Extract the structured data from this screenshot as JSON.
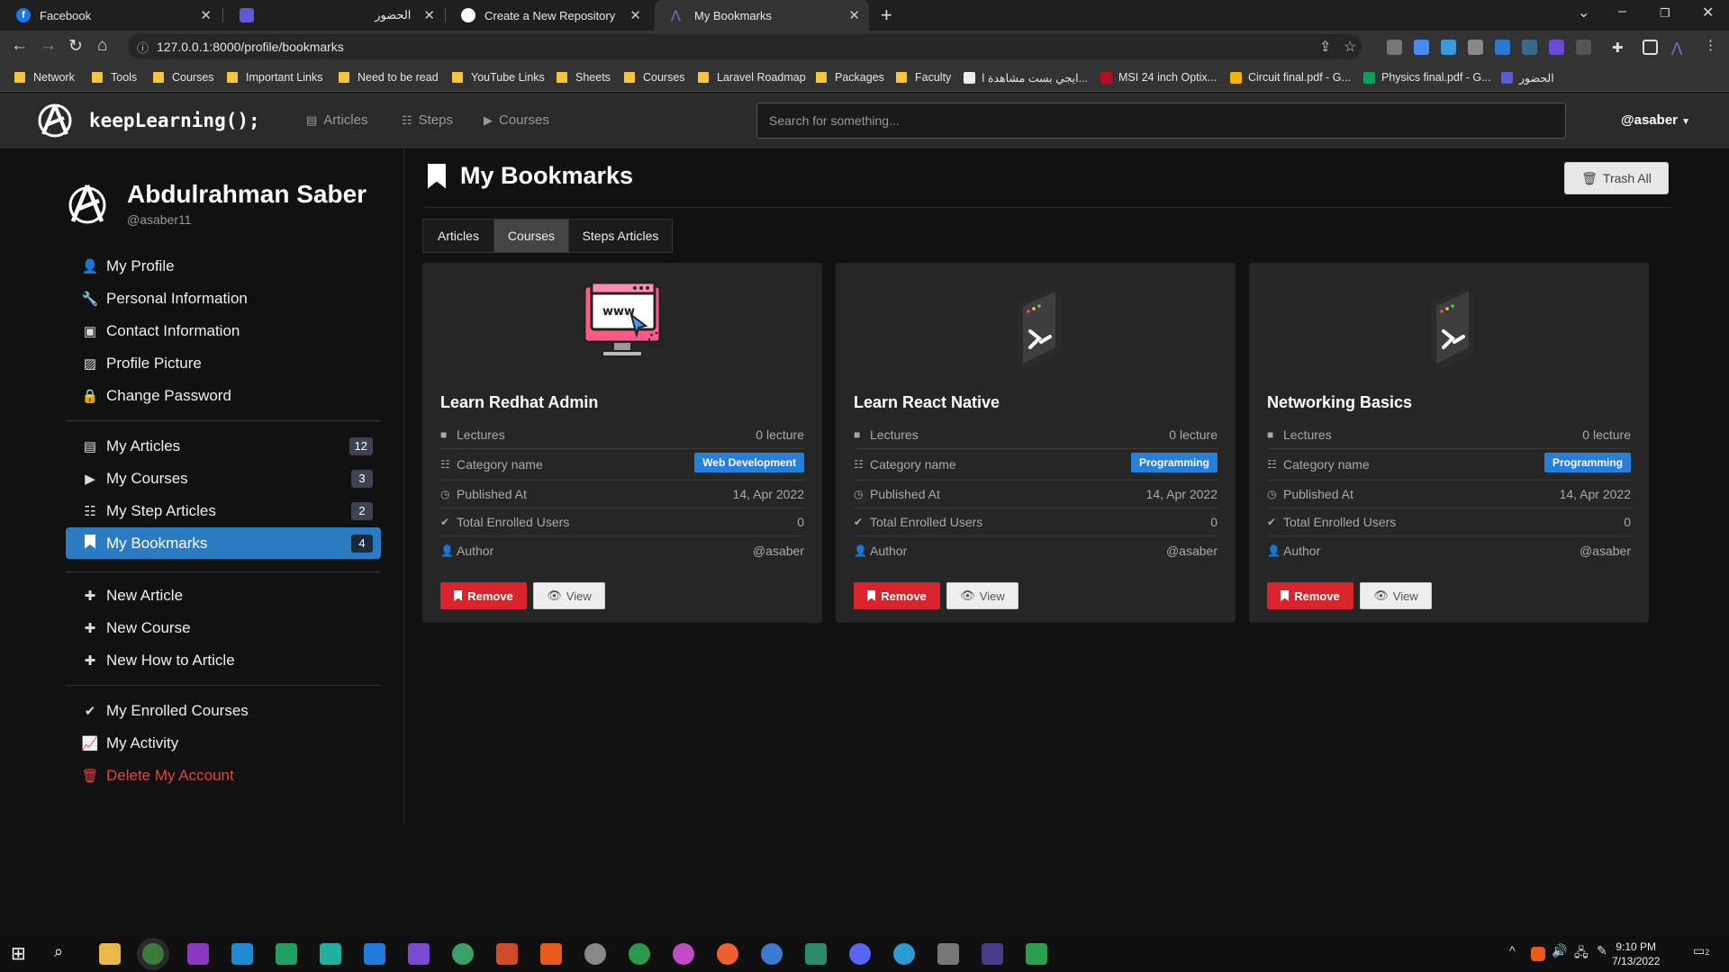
{
  "browser": {
    "tabs": [
      {
        "label": "Facebook",
        "color": "#1877f2"
      },
      {
        "label": "الحضور",
        "color": "#5b5bd6"
      },
      {
        "label": "Create a New Repository",
        "color": "#ffffff"
      },
      {
        "label": "My Bookmarks",
        "color": "#5a6fd6"
      }
    ],
    "url": "127.0.0.1:8000/profile/bookmarks",
    "bookmarks": [
      {
        "label": "Network",
        "type": "folder"
      },
      {
        "label": "Tools",
        "type": "folder"
      },
      {
        "label": "Courses",
        "type": "folder"
      },
      {
        "label": "Important Links",
        "type": "folder"
      },
      {
        "label": "Need to be read",
        "type": "folder"
      },
      {
        "label": "YouTube Links",
        "type": "folder"
      },
      {
        "label": "Sheets",
        "type": "folder"
      },
      {
        "label": "Courses",
        "type": "folder"
      },
      {
        "label": "Laravel Roadmap",
        "type": "folder"
      },
      {
        "label": "Packages",
        "type": "folder"
      },
      {
        "label": "Faculty",
        "type": "folder"
      },
      {
        "label": "ايجي بست مشاهدة ا...",
        "type": "site"
      },
      {
        "label": "MSI 24 inch Optix...",
        "type": "site"
      },
      {
        "label": "Circuit final.pdf - G...",
        "type": "site"
      },
      {
        "label": "Physics final.pdf - G...",
        "type": "site"
      },
      {
        "label": "الحضور",
        "type": "site"
      }
    ]
  },
  "site": {
    "brand": "keepLearning();",
    "nav": [
      {
        "label": "Articles",
        "icon": "newspaper-icon"
      },
      {
        "label": "Steps",
        "icon": "list-icon"
      },
      {
        "label": "Courses",
        "icon": "play-icon"
      }
    ],
    "search_placeholder": "Search for something...",
    "user_menu": "@asaber"
  },
  "profile": {
    "name": "Abdulrahman Saber",
    "handle": "@asaber11"
  },
  "sidebar": {
    "group1": [
      {
        "label": "My Profile",
        "icon": "user-icon"
      },
      {
        "label": "Personal Information",
        "icon": "wrench-icon"
      },
      {
        "label": "Contact Information",
        "icon": "id-card-icon"
      },
      {
        "label": "Profile Picture",
        "icon": "image-icon"
      },
      {
        "label": "Change Password",
        "icon": "lock-icon"
      }
    ],
    "group2": [
      {
        "label": "My Articles",
        "icon": "newspaper-icon",
        "count": "12"
      },
      {
        "label": "My Courses",
        "icon": "play-icon",
        "count": "3"
      },
      {
        "label": "My Step Articles",
        "icon": "list-icon",
        "count": "2"
      },
      {
        "label": "My Bookmarks",
        "icon": "bookmark-icon",
        "count": "4"
      }
    ],
    "group3": [
      {
        "label": "New Article",
        "icon": "plus-icon"
      },
      {
        "label": "New Course",
        "icon": "plus-icon"
      },
      {
        "label": "New How to Article",
        "icon": "plus-icon"
      }
    ],
    "group4": [
      {
        "label": "My Enrolled Courses",
        "icon": "check-icon"
      },
      {
        "label": "My Activity",
        "icon": "chart-line-icon"
      },
      {
        "label": "Delete My Account",
        "icon": "trash-icon"
      }
    ]
  },
  "main": {
    "title": "My Bookmarks",
    "trash_all": "Trash All",
    "tabs": [
      "Articles",
      "Courses",
      "Steps Articles"
    ],
    "selected_tab": "Courses",
    "card_labels": {
      "lectures": "Lectures",
      "category": "Category name",
      "published": "Published At",
      "enrolled": "Total Enrolled Users",
      "author": "Author",
      "remove": "Remove",
      "view": "View"
    },
    "cards": [
      {
        "title": "Learn Redhat Admin",
        "lectures": "0 lecture",
        "category": "Web Development",
        "published": "14, Apr 2022",
        "enrolled": "0",
        "author": "@asaber",
        "thumb": "www-monitor-icon"
      },
      {
        "title": "Learn React Native",
        "lectures": "0 lecture",
        "category": "Programming",
        "published": "14, Apr 2022",
        "enrolled": "0",
        "author": "@asaber",
        "thumb": "terminal-icon"
      },
      {
        "title": "Networking Basics",
        "lectures": "0 lecture",
        "category": "Programming",
        "published": "14, Apr 2022",
        "enrolled": "0",
        "author": "@asaber",
        "thumb": "terminal-icon"
      }
    ]
  },
  "taskbar": {
    "time": "9:10 PM",
    "date": "7/13/2022",
    "notifications": "2"
  },
  "colors": {
    "accent": "#2b7bc3",
    "danger": "#d9242b",
    "badge": "#2680d9"
  }
}
